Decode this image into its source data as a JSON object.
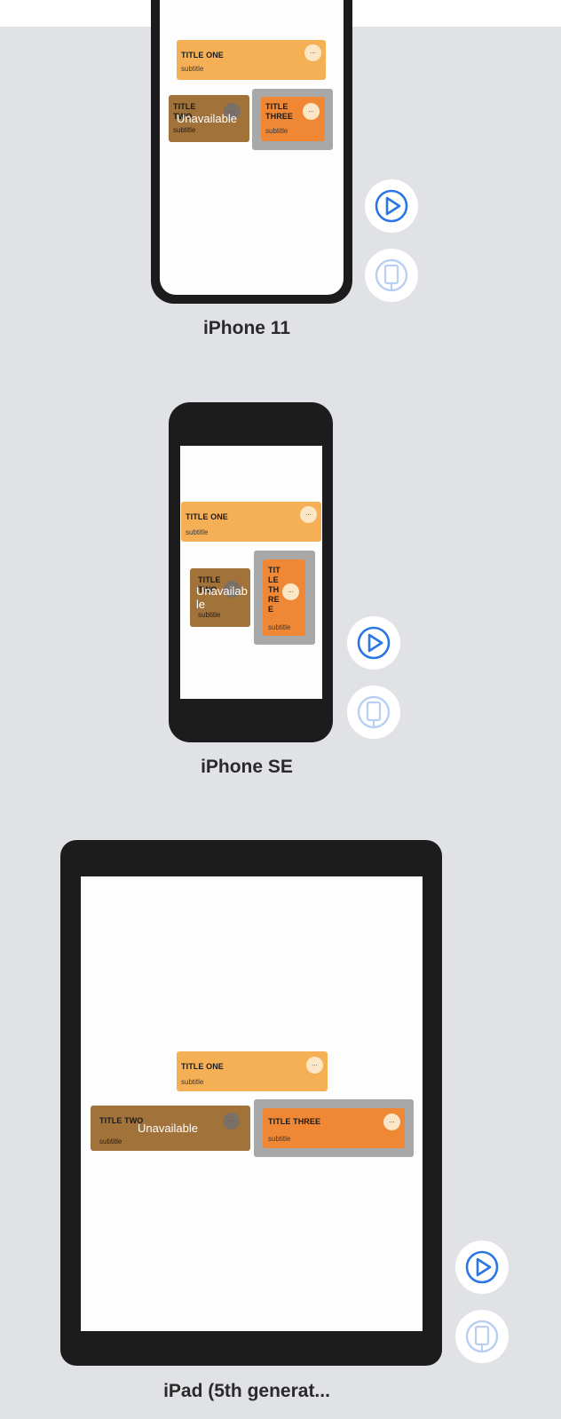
{
  "colors": {
    "canvas_bg": "#e1e2e6",
    "device_bezel": "#1c1c1c",
    "card_one": "#f5b056",
    "card_two": "#a1733a",
    "card_three": "#ef8734",
    "selection_frame": "#a8a8a8",
    "accent_blue": "#2b76e6"
  },
  "cards": {
    "one": {
      "title": "TITLE ONE",
      "subtitle": "subtitle",
      "more": "..."
    },
    "two": {
      "title": "TITLE TWO",
      "subtitle": "subtitle",
      "more": "...",
      "overlay": "Unavailable"
    },
    "three": {
      "title": "TITLE THREE",
      "subtitle": "subtitle",
      "more": "..."
    }
  },
  "devices": [
    {
      "label": "iPhone 11",
      "play_icon": "play-circle-icon",
      "device_icon": "device-rotate-icon"
    },
    {
      "label": "iPhone SE",
      "play_icon": "play-circle-icon",
      "device_icon": "device-rotate-icon"
    },
    {
      "label": "iPad (5th generat...",
      "play_icon": "play-circle-icon",
      "device_icon": "device-rotate-icon"
    }
  ]
}
